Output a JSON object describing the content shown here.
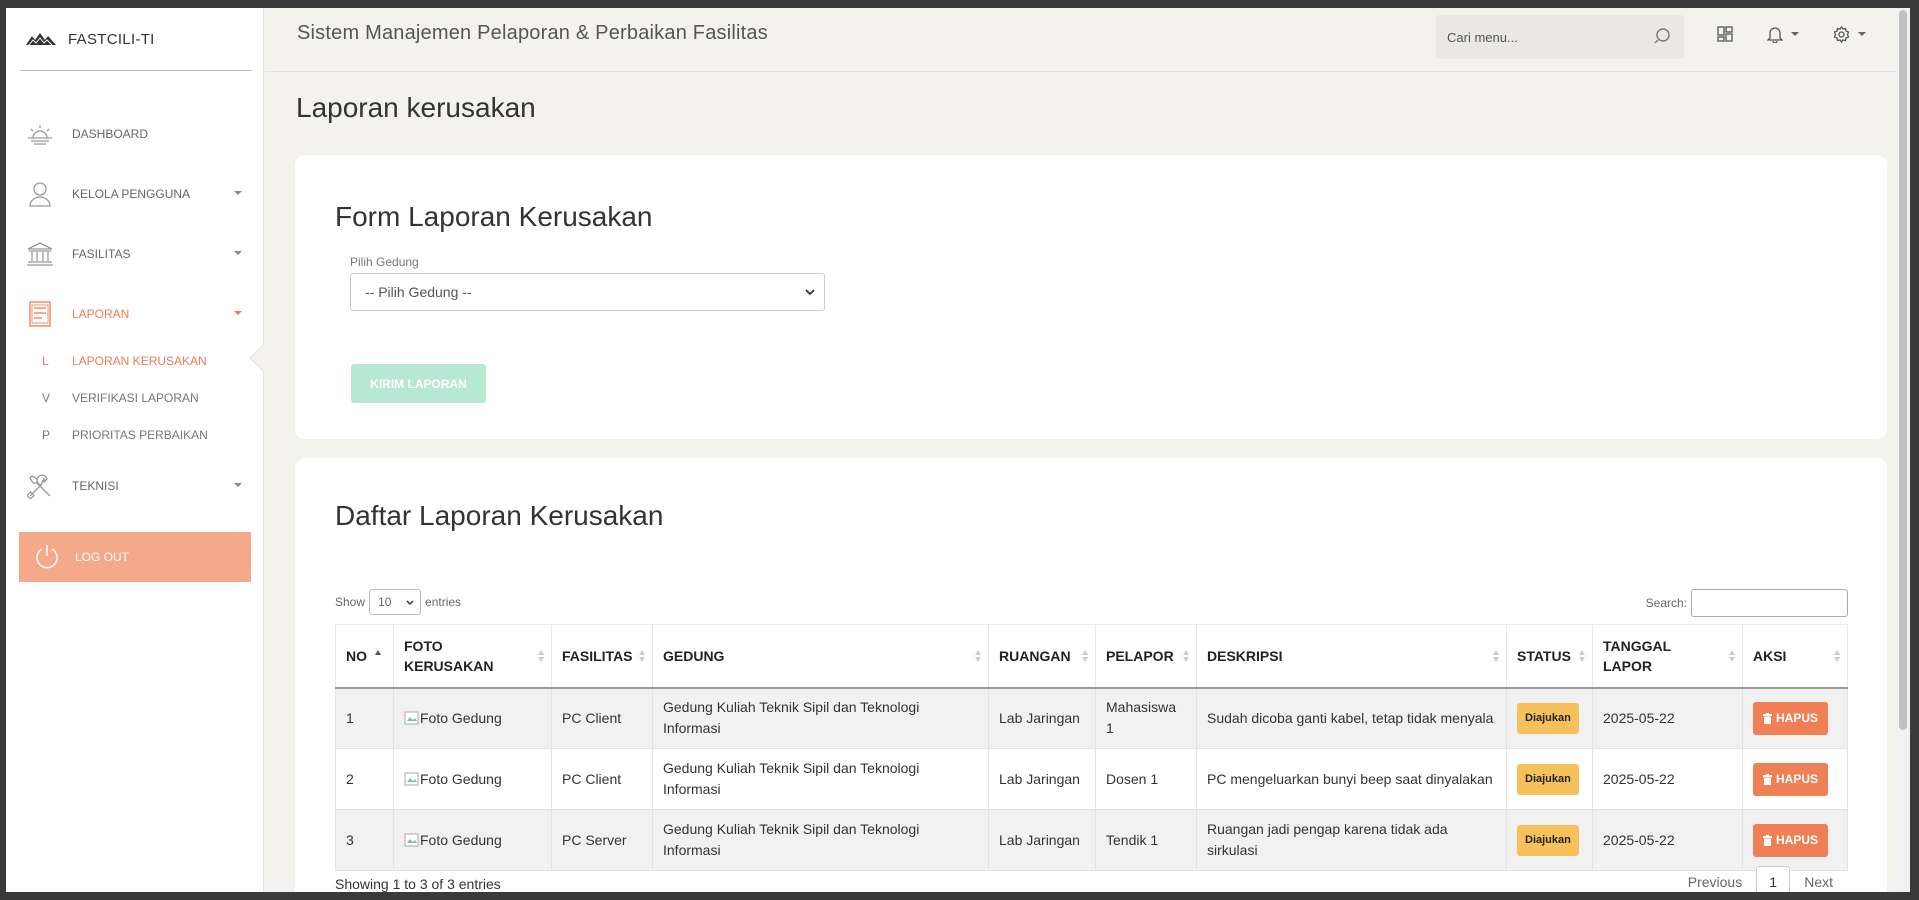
{
  "brand": {
    "name": "FASTCILI-TI"
  },
  "sidebar": {
    "items": [
      {
        "label": "DASHBOARD",
        "icon": "sunrise-icon"
      },
      {
        "label": "KELOLA PENGGUNA",
        "icon": "user-icon"
      },
      {
        "label": "FASILITAS",
        "icon": "building-icon"
      },
      {
        "label": "LAPORAN",
        "icon": "report-icon"
      },
      {
        "label": "TEKNISI",
        "icon": "tools-icon"
      }
    ],
    "sub_items": [
      {
        "letter": "L",
        "label": "LAPORAN KERUSAKAN"
      },
      {
        "letter": "V",
        "label": "VERIFIKASI LAPORAN"
      },
      {
        "letter": "P",
        "label": "PRIORITAS PERBAIKAN"
      }
    ],
    "logout": "LOG OUT"
  },
  "header": {
    "title": "Sistem Manajemen Pelaporan & Perbaikan Fasilitas",
    "search_placeholder": "Cari menu..."
  },
  "page": {
    "title": "Laporan kerusakan"
  },
  "form": {
    "title": "Form Laporan Kerusakan",
    "gedung_label": "Pilih Gedung",
    "gedung_value": "-- Pilih Gedung --",
    "submit": "KIRIM LAPORAN"
  },
  "list": {
    "title": "Daftar Laporan Kerusakan",
    "show": "Show",
    "length": "10",
    "entries": "entries",
    "search_label": "Search:",
    "columns": [
      "NO",
      "FOTO KERUSAKAN",
      "FASILITAS",
      "GEDUNG",
      "RUANGAN",
      "PELAPOR",
      "DESKRIPSI",
      "STATUS",
      "TANGGAL LAPOR",
      "AKSI"
    ],
    "rows": [
      {
        "no": "1",
        "foto": "Foto Gedung",
        "fasilitas": "PC Client",
        "gedung": "Gedung Kuliah Teknik Sipil dan Teknologi Informasi",
        "ruangan": "Lab Jaringan",
        "pelapor": "Mahasiswa 1",
        "deskripsi": "Sudah dicoba ganti kabel, tetap tidak menyala",
        "status": "Diajukan",
        "tanggal": "2025-05-22",
        "aksi": "HAPUS"
      },
      {
        "no": "2",
        "foto": "Foto Gedung",
        "fasilitas": "PC Client",
        "gedung": "Gedung Kuliah Teknik Sipil dan Teknologi Informasi",
        "ruangan": "Lab Jaringan",
        "pelapor": "Dosen 1",
        "deskripsi": "PC mengeluarkan bunyi beep saat dinyalakan",
        "status": "Diajukan",
        "tanggal": "2025-05-22",
        "aksi": "HAPUS"
      },
      {
        "no": "3",
        "foto": "Foto Gedung",
        "fasilitas": "PC Server",
        "gedung": "Gedung Kuliah Teknik Sipil dan Teknologi Informasi",
        "ruangan": "Lab Jaringan",
        "pelapor": "Tendik 1",
        "deskripsi": "Ruangan jadi pengap karena tidak ada sirkulasi",
        "status": "Diajukan",
        "tanggal": "2025-05-22",
        "aksi": "HAPUS"
      }
    ],
    "info": "Showing 1 to 3 of 3 entries",
    "prev": "Previous",
    "page": "1",
    "next": "Next"
  },
  "colors": {
    "accent": "#ee7b55",
    "logout_bg": "#f4a98a",
    "submit_bg": "#b7e8d2",
    "badge": "#f6c15b",
    "danger": "#ef7f55"
  }
}
